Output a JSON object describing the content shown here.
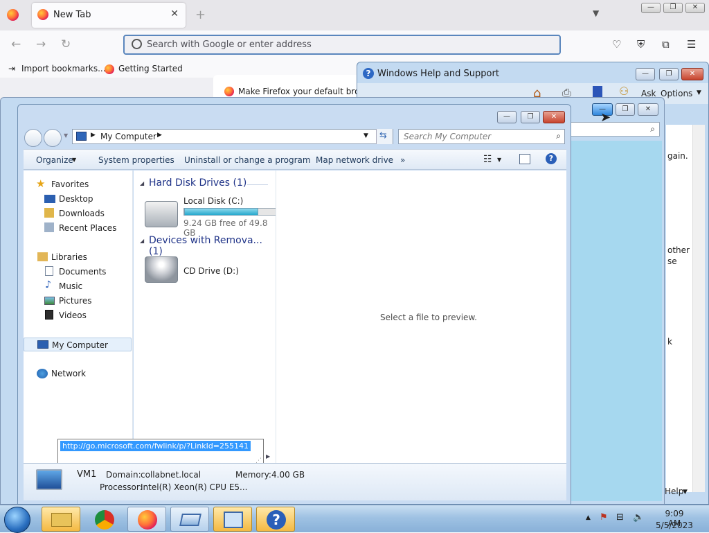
{
  "firefox": {
    "tab_title": "New Tab",
    "tab_close": "✕",
    "new_tab": "+",
    "tab_list": "▼",
    "url_placeholder": "Search with Google or enter address",
    "bookmarks": [
      "Import bookmarks...",
      "Getting Started"
    ],
    "default_banner": "Make Firefox your default brows",
    "win_buttons": [
      "—",
      "❐",
      "✕"
    ]
  },
  "help_window": {
    "title": "Windows Help and Support",
    "ask": "Ask",
    "options": "Options",
    "fragments": [
      "gain.",
      "other",
      "se",
      "k"
    ],
    "help_menu": "Help"
  },
  "my_computer": {
    "address": "My Computer",
    "search_placeholder": "Search My Computer",
    "commands": [
      "Organize",
      "System properties",
      "Uninstall or change a program",
      "Map network drive",
      "»"
    ],
    "nav": {
      "favorites": "Favorites",
      "favorites_items": [
        "Desktop",
        "Downloads",
        "Recent Places"
      ],
      "libraries": "Libraries",
      "libraries_items": [
        "Documents",
        "Music",
        "Pictures",
        "Videos"
      ],
      "computer": "My Computer",
      "network": "Network"
    },
    "groups": {
      "hdd_header": "Hard Disk Drives (1)",
      "hdd_name": "Local Disk (C:)",
      "hdd_free": "9.24 GB free of 49.8 GB",
      "hdd_used_fraction": 0.81,
      "removable_header": "Devices with Remova... (1)",
      "cd_name": "CD Drive (D:)"
    },
    "preview_text": "Select a file to preview.",
    "details": {
      "name": "VM1",
      "domain_key": "Domain:",
      "domain_val": "collabnet.local",
      "memory_key": "Memory:",
      "memory_val": "4.00 GB",
      "processor_key": "Processor:",
      "processor_val": "Intel(R) Xeon(R) CPU E5..."
    },
    "tooltip_link": "http://go.microsoft.com/fwlink/p/?LinkId=255141"
  },
  "taskbar": {
    "time": "9:09 AM",
    "date": "5/5/2023"
  }
}
